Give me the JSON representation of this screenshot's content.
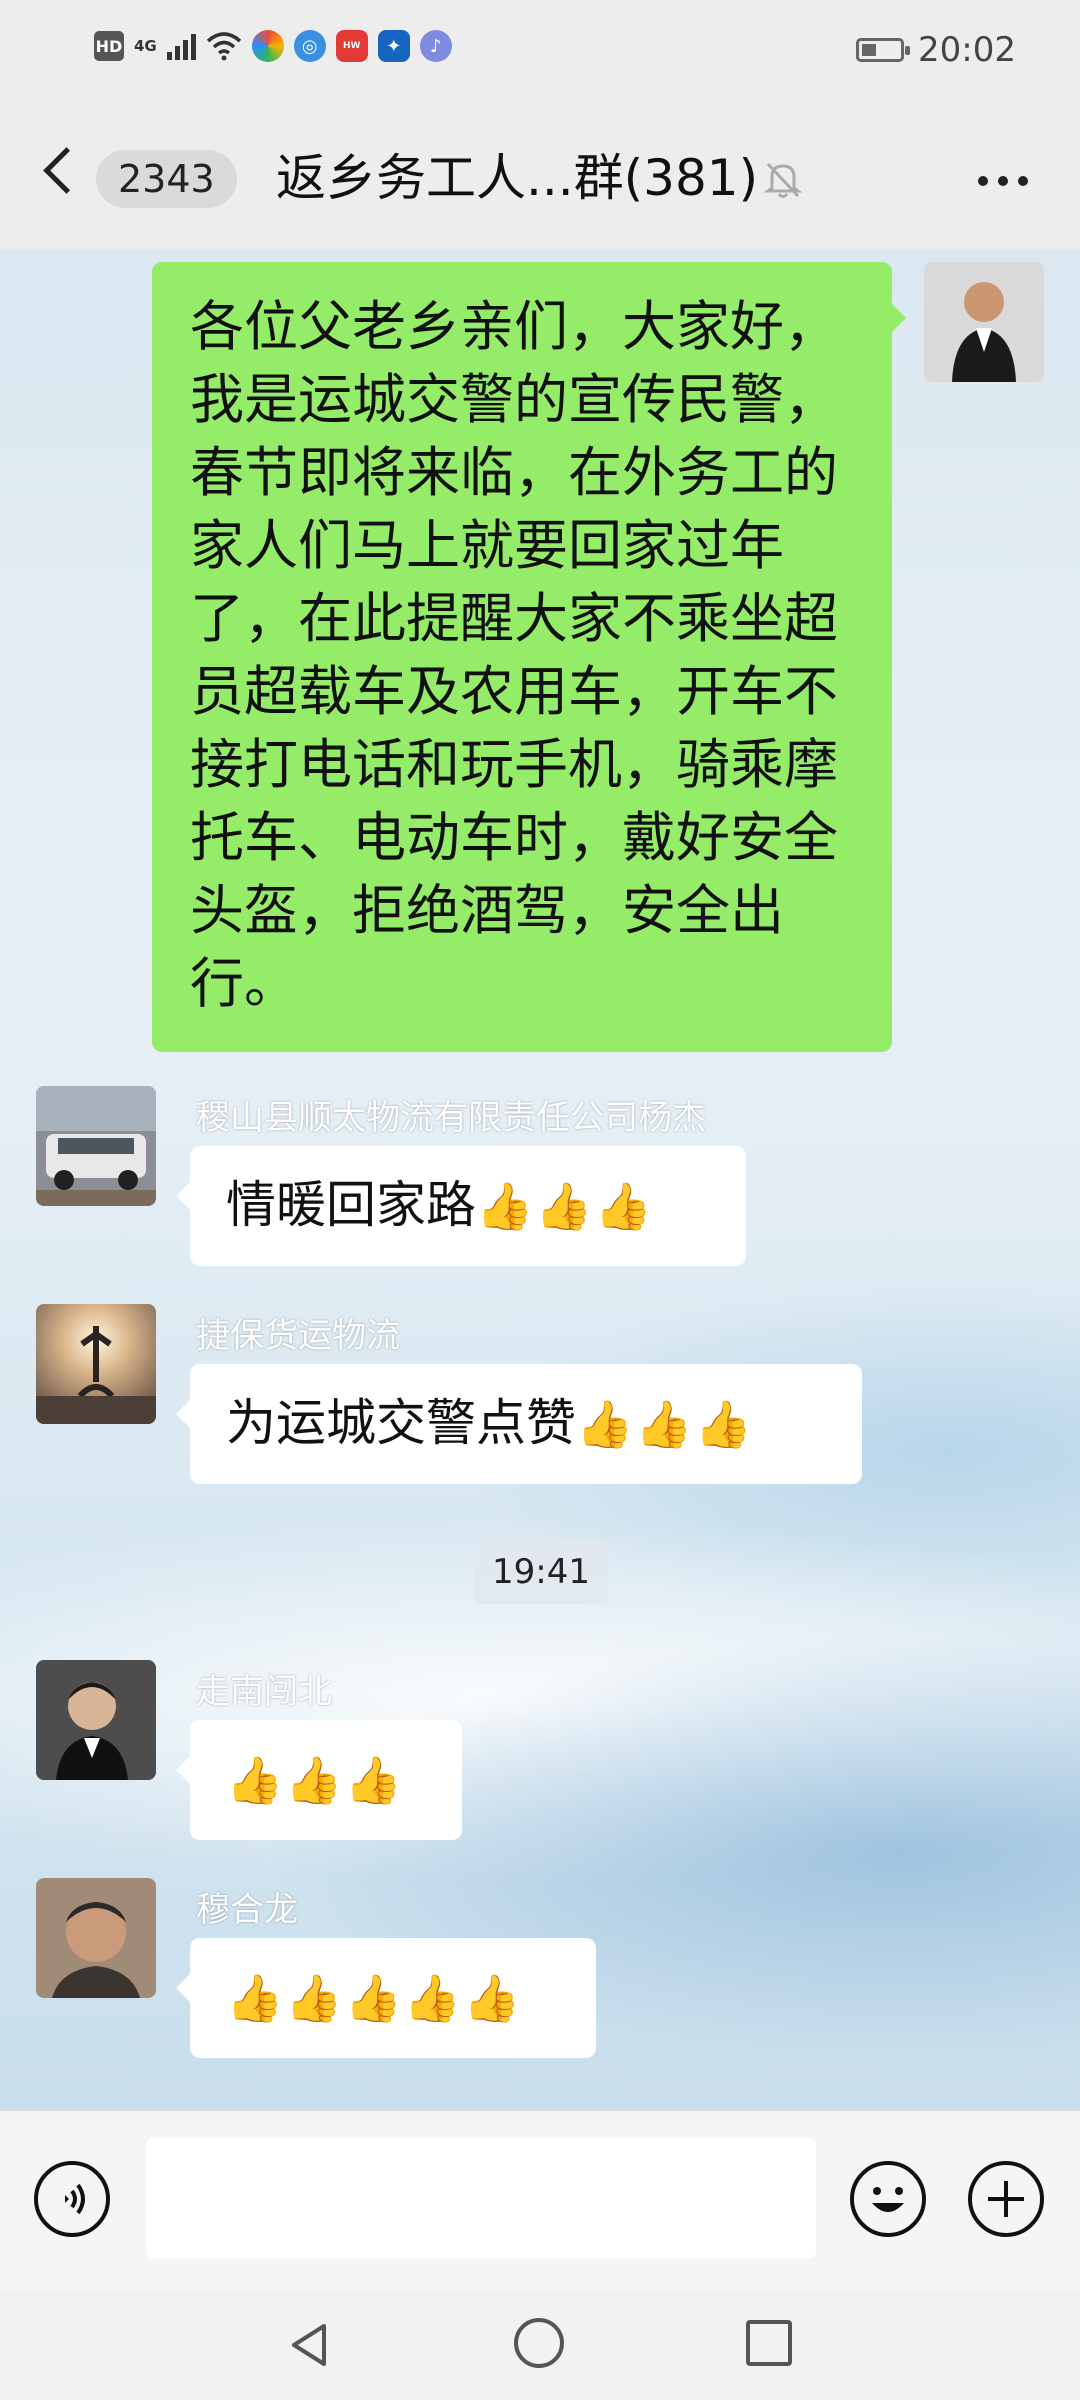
{
  "status_bar": {
    "hd": "HD",
    "network": "4G",
    "time": "20:02",
    "app_icons": [
      "maps-icon",
      "browser-icon",
      "huawei-icon",
      "lightbulb-icon",
      "music-icon"
    ]
  },
  "header": {
    "unread_count": "2343",
    "title": "返乡务工人...群(381)",
    "mute_icon": "muted-bell-icon",
    "more_icon": "more-dots-icon"
  },
  "messages": [
    {
      "type": "outgoing",
      "text": "各位父老乡亲们，大家好，我是运城交警的宣传民警，春节即将来临，在外务工的家人们马上就要回家过年了，在此提醒大家不乘坐超员超载车及农用车，开车不接打电话和玩手机，骑乘摩托车、电动车时，戴好安全头盔，拒绝酒驾，安全出行。"
    },
    {
      "type": "incoming",
      "sender": "稷山县顺太物流有限责任公司杨杰",
      "text": "情暖回家路",
      "emoji": "👍👍👍"
    },
    {
      "type": "incoming",
      "sender": "捷保货运物流",
      "text": "为运城交警点赞",
      "emoji": "👍👍👍"
    },
    {
      "type": "time",
      "text": "19:41"
    },
    {
      "type": "incoming",
      "sender": "走南闯北",
      "text": "",
      "emoji": "👍👍👍"
    },
    {
      "type": "incoming",
      "sender": "穆合龙",
      "text": "",
      "emoji": "👍👍👍👍👍"
    }
  ],
  "input_bar": {
    "voice_icon": "voice-icon",
    "input_value": "",
    "emoji_icon": "emoji-icon",
    "plus_icon": "plus-icon"
  },
  "colors": {
    "outgoing_bubble": "#95ec69",
    "incoming_bubble": "#ffffff",
    "header_bg": "#ededed"
  }
}
